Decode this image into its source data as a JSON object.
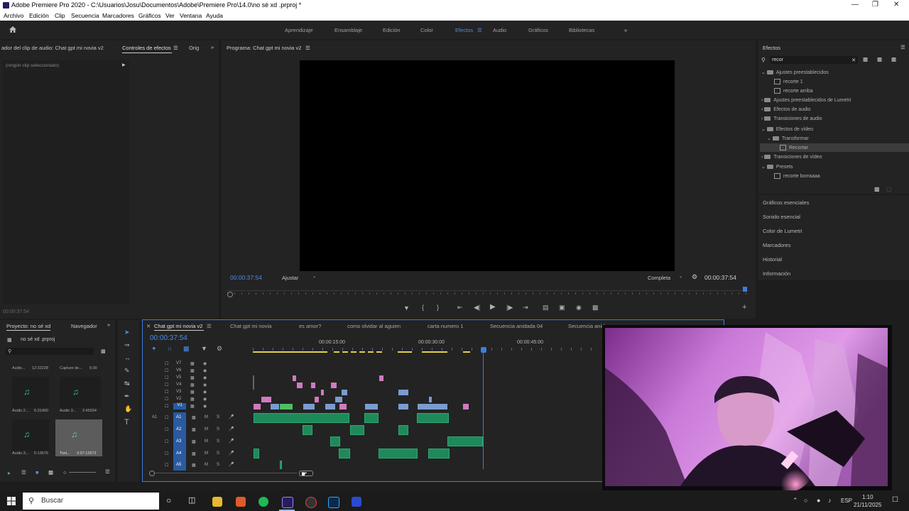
{
  "window": {
    "title": "Adobe Premiere Pro 2020 - C:\\Usuarios\\Josu\\Documentos\\Adobe\\Premiere Pro\\14.0\\no sé xd .prproj *"
  },
  "menu": [
    "Archivo",
    "Edición",
    "Clip",
    "Secuencia",
    "Marcadores",
    "Gráficos",
    "Ver",
    "Ventana",
    "Ayuda"
  ],
  "workspaces": [
    "Aprendizaje",
    "Ensamblaje",
    "Edición",
    "Color",
    "Efectos",
    "Audio",
    "Gráficos",
    "Bibliotecas"
  ],
  "workspace_active": "Efectos",
  "left_panel": {
    "tab_audio_mixer": "ador del clip de audio: Chat gpt mi novia v2",
    "tab_effect_controls": "Controles de efectos",
    "tab_source": "Orig",
    "no_clip": "(ningún clip seleccionado)",
    "timecode": "00:00:37:54"
  },
  "program_monitor": {
    "title": "Programa: Chat gpt mi novia v2",
    "timecode_left": "00:00:37:54",
    "fit": "Ajustar",
    "resolution": "Completa",
    "timecode_right": "00:00:37:54"
  },
  "effects_panel": {
    "title": "Efectos",
    "search_value": "recor",
    "tree": [
      {
        "label": "Ajustes preestablecidos",
        "kind": "folder",
        "level": 0
      },
      {
        "label": "recorte 1",
        "kind": "preset",
        "level": 1
      },
      {
        "label": "recorte arriba",
        "kind": "preset",
        "level": 1
      },
      {
        "label": "Ajustes preestablecidos de Lumetri",
        "kind": "folder",
        "level": 0
      },
      {
        "label": "Efectos de audio",
        "kind": "folder",
        "level": 0
      },
      {
        "label": "Transiciones de audio",
        "kind": "folder",
        "level": 0
      },
      {
        "label": "Efectos de vídeo",
        "kind": "folder",
        "level": 0
      },
      {
        "label": "Transformar",
        "kind": "folder",
        "level": 1
      },
      {
        "label": "Recortar",
        "kind": "preset",
        "level": 2
      },
      {
        "label": "Transiciones de vídeo",
        "kind": "folder",
        "level": 0
      },
      {
        "label": "Presets",
        "kind": "folder",
        "level": 0
      },
      {
        "label": "recorte borraaaa",
        "kind": "preset",
        "level": 1
      }
    ],
    "selected": "Recortar"
  },
  "side_panels": [
    "Gráficos esenciales",
    "Sonido esencial",
    "Color de Lumetri",
    "Marcadores",
    "Historial",
    "Información"
  ],
  "project_panel": {
    "tab_project": "Proyecto: no sé xd",
    "tab_navigator": "Navegador",
    "file": "no sé xd .prproj",
    "items": [
      {
        "name": "Audio...",
        "duration": "12:32228"
      },
      {
        "name": "Capture de...",
        "duration": "5:00"
      },
      {
        "name": "Audio 2...",
        "duration": "6:31490"
      },
      {
        "name": "Audio 3...",
        "duration": "2:45934"
      },
      {
        "name": "Audio 3...",
        "duration": "5:13676"
      },
      {
        "name": "Toni...",
        "duration": "3:57:12672"
      }
    ]
  },
  "timeline": {
    "tabs": [
      "Chat gpt mi novia v2",
      "Chat gpt mi novia",
      "es amor?",
      "como olvidar al aguien",
      "carta numero 1",
      "Secuencia anidada 04",
      "Secuencia anid"
    ],
    "timecode": "00:00:37:54",
    "ruler": [
      "00:00:15:00",
      "00:00:30:00",
      "00:00:45:00"
    ],
    "video_tracks": [
      "V7",
      "V6",
      "V5",
      "V4",
      "V3",
      "V2",
      "V1"
    ],
    "audio_tracks": [
      "A1",
      "A2",
      "A3",
      "A4",
      "A5"
    ],
    "track_m": "M",
    "track_s": "S",
    "source_patch": "A1"
  },
  "taskbar": {
    "search": "Buscar",
    "lang": "ESP",
    "time": "1:10",
    "date": "21/11/2025"
  },
  "colors": {
    "accent": "#4d8ce8",
    "video_clip": "#d07ac0",
    "audio_clip": "#1e8a5a",
    "playhead": "#3b7de0"
  }
}
